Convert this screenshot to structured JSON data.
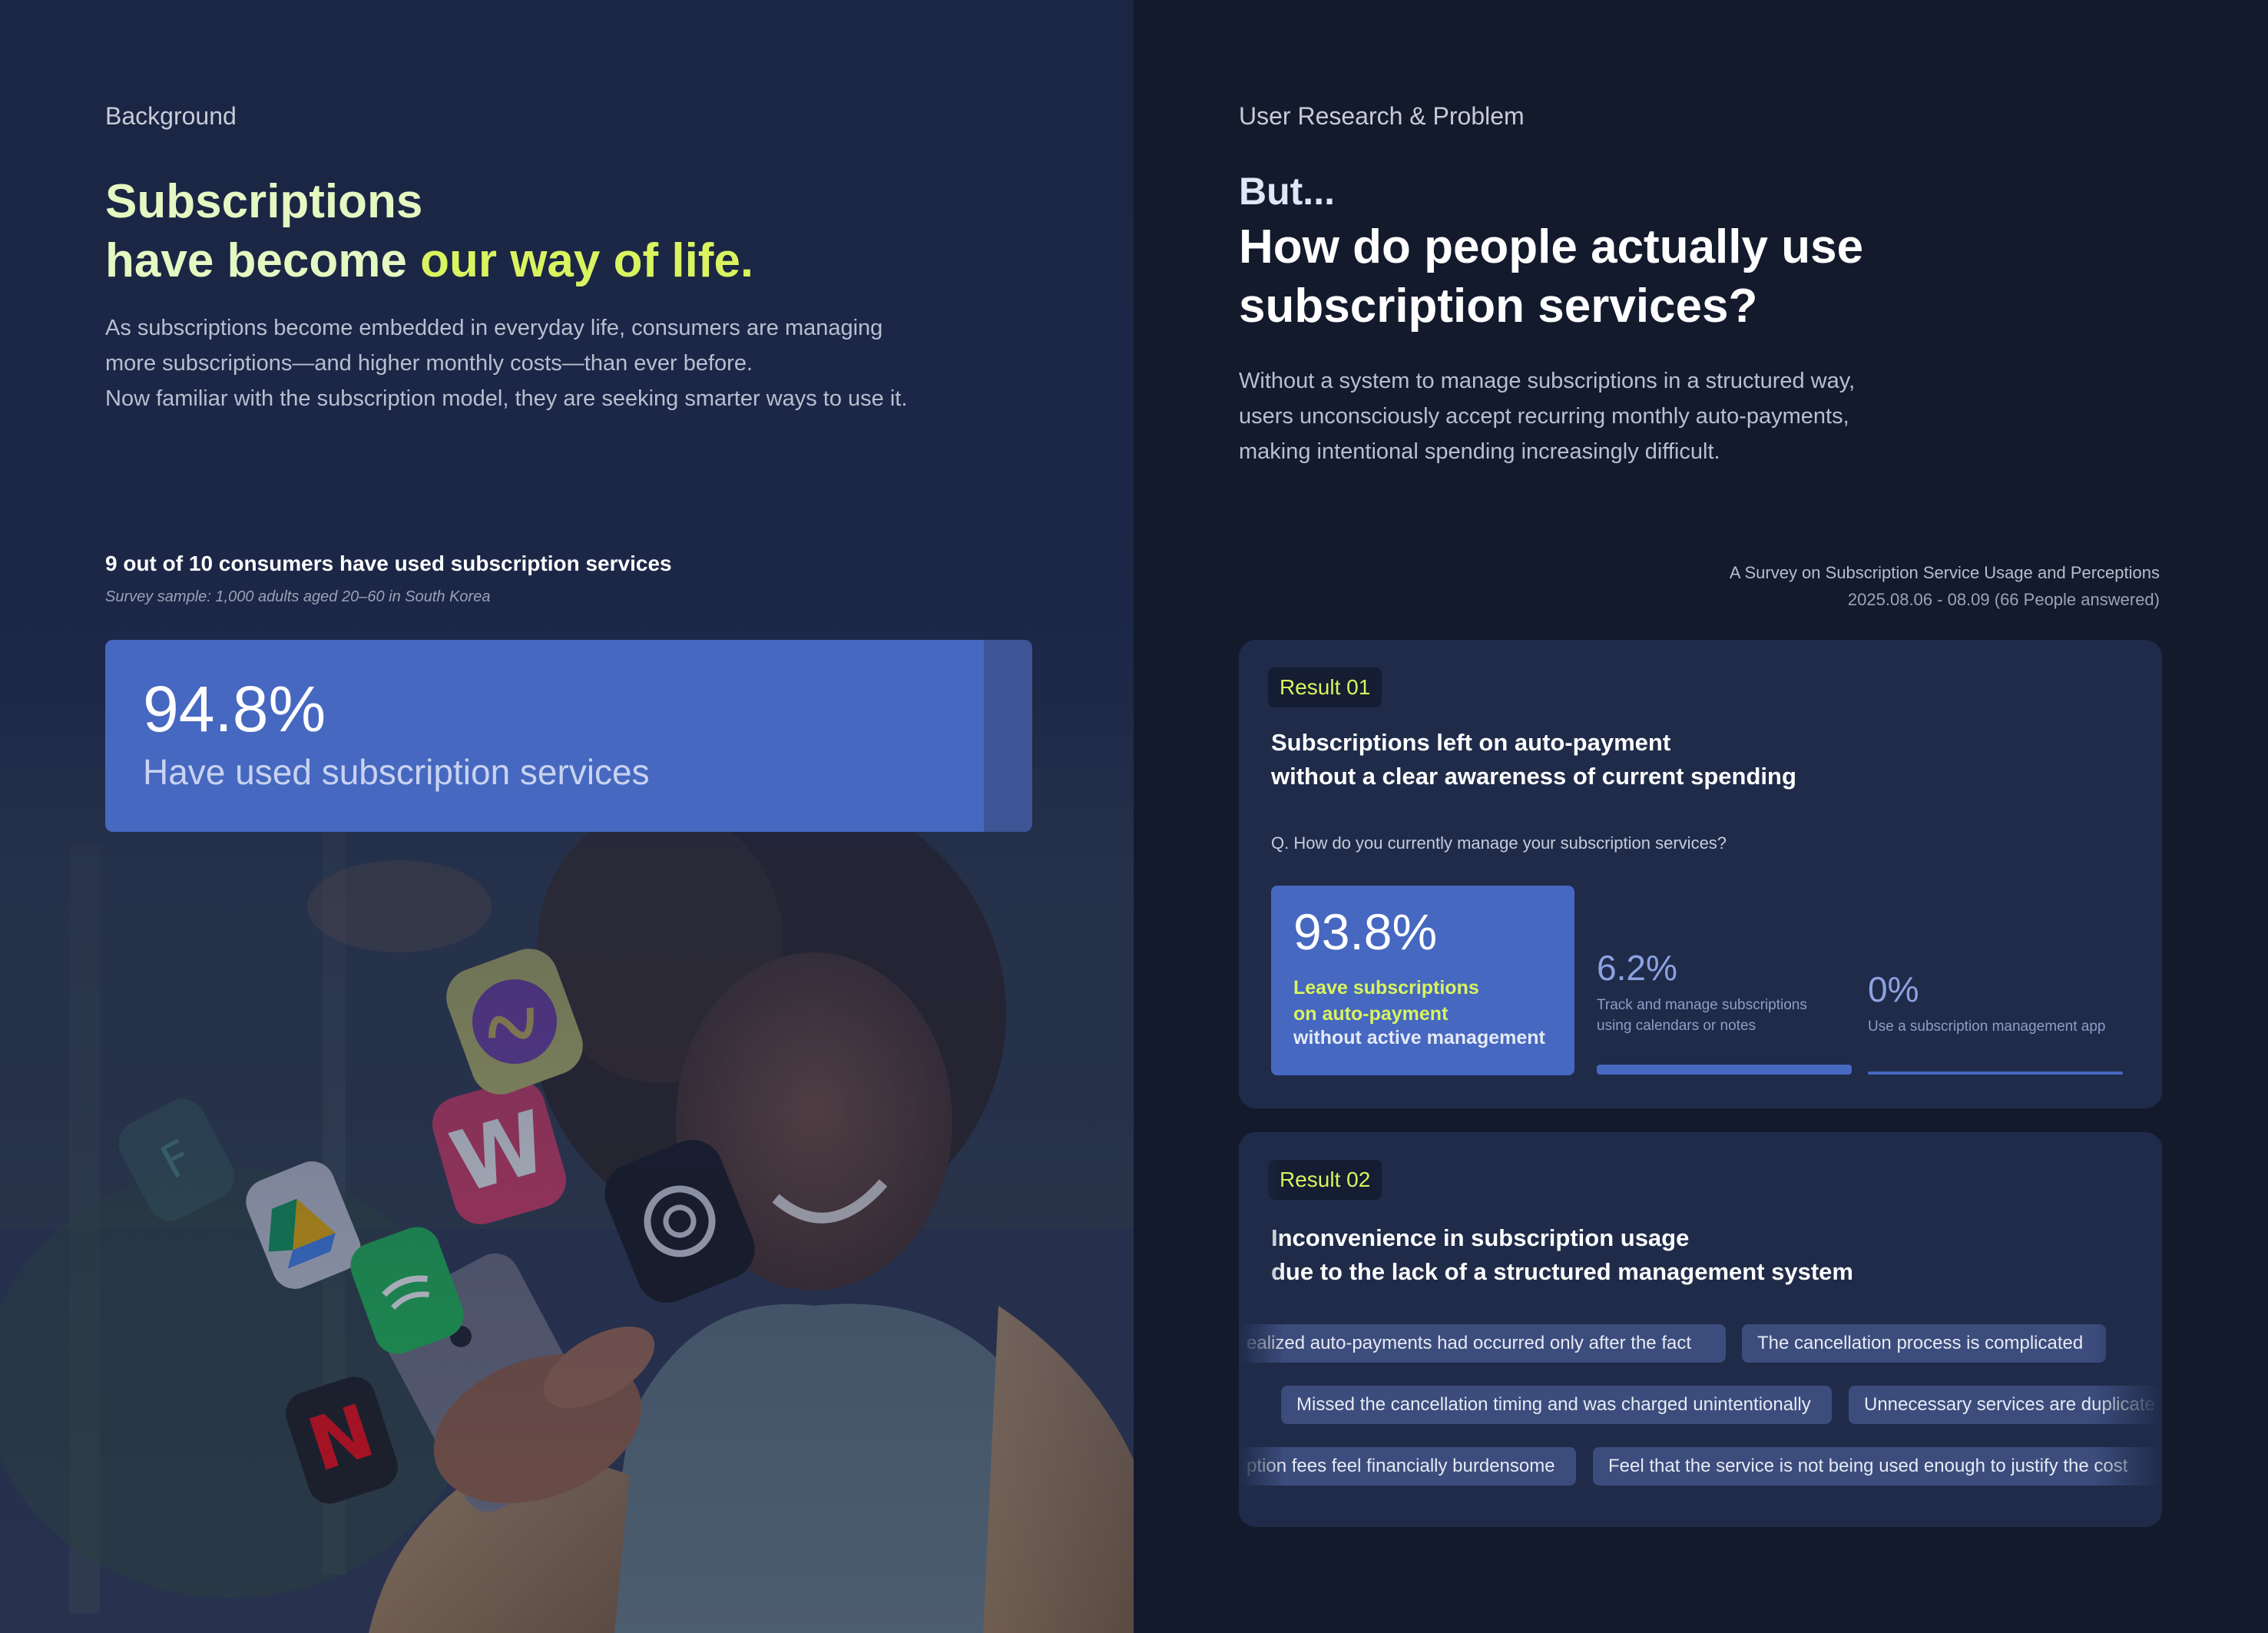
{
  "background": {
    "section_label": "Background",
    "headline_line1": "Subscriptions",
    "headline_line2_prefix": "have become ",
    "headline_line2_accent": "our way of life.",
    "paragraph_line1": "As subscriptions become embedded in everyday life, consumers are managing",
    "paragraph_line2": "more subscriptions—and higher monthly costs—than ever before.",
    "paragraph_line3": "Now familiar with the subscription model, they are seeking smarter ways to use it.",
    "stat_title": "9 out of 10 consumers have used subscription services",
    "stat_note": "Survey sample: 1,000 adults aged 20–60 in South Korea",
    "stat_value": "94.8%",
    "stat_fraction": 0.948,
    "stat_label": "Have used subscription services",
    "app_icons": [
      "fandom-icon",
      "google-drive-icon",
      "spotify-icon",
      "netflix-icon",
      "wattpad-icon",
      "music-app-icon",
      "chatgpt-icon"
    ]
  },
  "research": {
    "section_label": "User Research & Problem",
    "question_small": "But...",
    "question_line1": "How do people actually use",
    "question_line2": "subscription services?",
    "paragraph_line1": "Without a system to manage subscriptions in a structured way,",
    "paragraph_line2": "users unconsciously accept recurring monthly auto-payments,",
    "paragraph_line3": "making intentional spending increasingly difficult.",
    "survey_title": "A Survey on Subscription Service Usage and Perceptions",
    "survey_meta": "2025.08.06 - 08.09 (66 People answered)",
    "result1": {
      "badge": "Result 01",
      "title_line1": "Subscriptions left on auto-payment",
      "title_line2": "without a clear awareness of current spending",
      "question": "Q. How do you currently manage your subscription services?",
      "main_value": "93.8%",
      "main_desc_line1": "Leave subscriptions",
      "main_desc_line2": "on auto-payment",
      "main_desc_line3": "without active management",
      "opt2_value": "6.2%",
      "opt2_desc_line1": "Track and manage subscriptions",
      "opt2_desc_line2": "using calendars or notes",
      "opt3_value": "0%",
      "opt3_desc": "Use a subscription management app"
    },
    "result2": {
      "badge": "Result 02",
      "title_line1": "Inconvenience in subscription usage",
      "title_line2": "due to the lack of a structured management system",
      "chip1": "ealized auto-payments had occurred only after the fact",
      "chip2": "The cancellation process is complicated",
      "chip3": "Missed the cancellation timing and was charged unintentionally",
      "chip4": "Unnecessary services are duplicate",
      "chip5": "ption fees feel financially burdensome",
      "chip6": "Feel that the service is not being used enough to justify the cost"
    }
  },
  "colors": {
    "accent_lime": "#d9f45f",
    "accent_blue": "#4668c0",
    "left_bg": "#1b2544",
    "right_bg": "#131a2c",
    "card_bg": "#1f2b49"
  }
}
